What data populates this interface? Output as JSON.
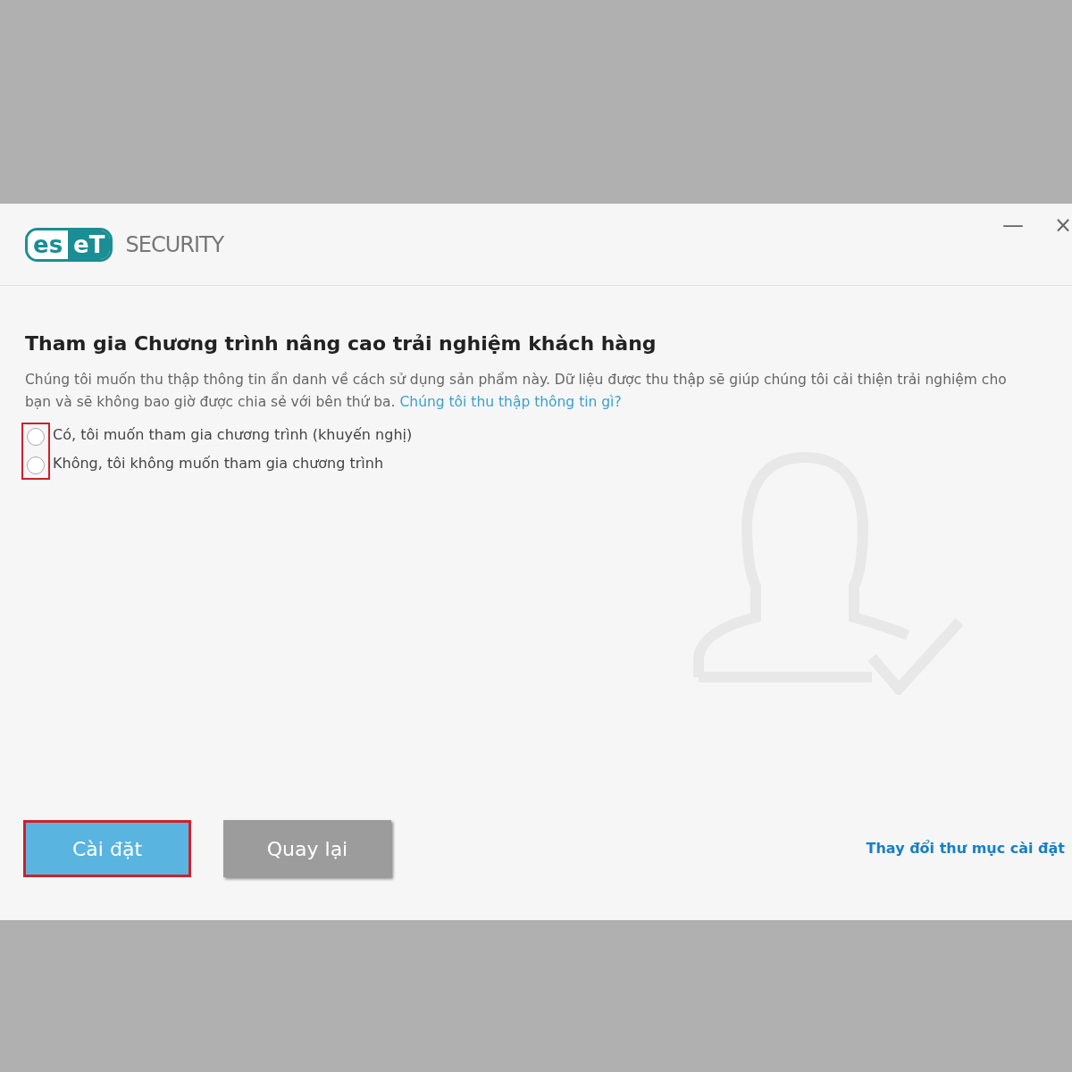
{
  "window": {
    "controls": [
      "—",
      "×"
    ]
  },
  "logo": {
    "mark_left": "es",
    "mark_right": "eT",
    "product": "SECURITY"
  },
  "heading": "Tham gia Chương trình nâng cao trải nghiệm khách hàng",
  "description": "Chúng tôi muốn thu thập thông tin ẩn danh về cách sử dụng sản phẩm này. Dữ liệu được thu thập sẽ giúp chúng tôi cải thiện trải nghiệm cho bạn và sẽ không bao giờ được chia sẻ với bên thứ ba.",
  "info_link": "Chúng tôi thu thập thông tin gì?",
  "options_highlighted": true,
  "options": [
    {
      "label": "Có, tôi muốn tham gia chương trình (khuyến nghị)",
      "selected": false
    },
    {
      "label": "Không, tôi không muốn tham gia chương trình",
      "selected": false
    }
  ],
  "buttons": [
    {
      "label": "Cài đặt",
      "kind": "primary",
      "highlighted": true
    },
    {
      "label": "Quay lại",
      "kind": "secondary",
      "highlighted": false
    }
  ],
  "folder_link": "Thay đổi thư mục cài đặt"
}
